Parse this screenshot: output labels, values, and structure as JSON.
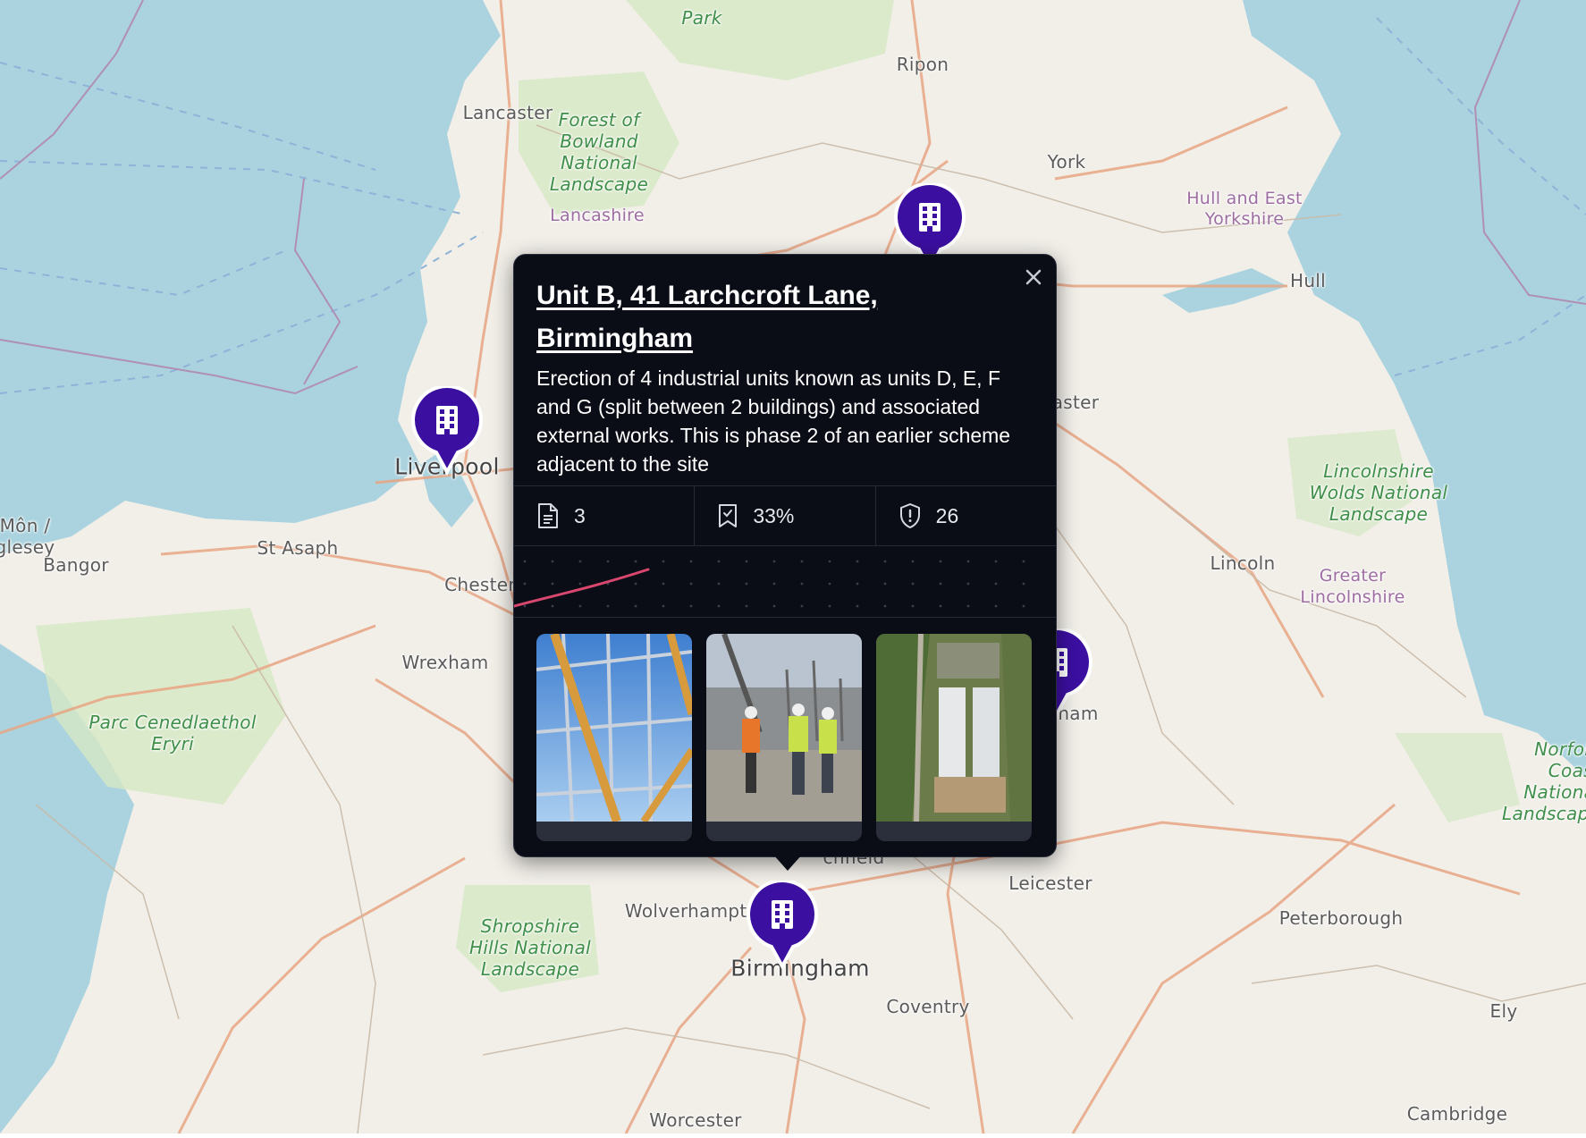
{
  "map": {
    "places": [
      {
        "name": "Park"
      },
      {
        "name": "Ripon"
      },
      {
        "name": "Lancaster"
      },
      {
        "name": "Forest of Bowland National Landscape"
      },
      {
        "name": "Lancashire"
      },
      {
        "name": "York"
      },
      {
        "name": "Hull and East Yorkshire"
      },
      {
        "name": "Hull"
      },
      {
        "name": "Liverpool"
      },
      {
        "name": "aster"
      },
      {
        "name": "Lincolnshire Wolds National Landscape"
      },
      {
        "name": "Môn / glesey"
      },
      {
        "name": "Bangor"
      },
      {
        "name": "St Asaph"
      },
      {
        "name": "Chester"
      },
      {
        "name": "Lincoln"
      },
      {
        "name": "Greater Lincolnshire"
      },
      {
        "name": "Wrexham"
      },
      {
        "name": "ham"
      },
      {
        "name": "Parc Cenedlaethol Eryri"
      },
      {
        "name": "Norfolk Coast National Landscape"
      },
      {
        "name": "Leicester"
      },
      {
        "name": "Wolverhampton"
      },
      {
        "name": "Peterborough"
      },
      {
        "name": "Shropshire Hills National Landscape"
      },
      {
        "name": "Birmingham"
      },
      {
        "name": "Coventry"
      },
      {
        "name": "Ely"
      },
      {
        "name": "Worcester"
      },
      {
        "name": "Cambridge"
      },
      {
        "name": "chfield"
      }
    ],
    "pins": [
      {
        "label": "Leeds site"
      },
      {
        "label": "Liverpool site"
      },
      {
        "label": "Nottingham site"
      },
      {
        "label": "Birmingham site"
      }
    ],
    "colors": {
      "sea": "#aad3df",
      "land": "#f2efe9",
      "park": "#d6e8c4",
      "road": "#e8a583",
      "pin": "#3b0fa0"
    }
  },
  "popup": {
    "title": "Unit B, 41 Larchcroft Lane, Birmingham",
    "description": "Erection of 4 industrial units known as units D, E, F and G (split between 2 buildings) and associated external works. This is phase 2 of an earlier scheme adjacent to the site",
    "stats": [
      {
        "icon": "document-icon",
        "value": "3"
      },
      {
        "icon": "bookmark-icon",
        "value": "33%"
      },
      {
        "icon": "shield-icon",
        "value": "26"
      }
    ],
    "sparkline": {
      "color": "#d9476f"
    },
    "photos": [
      {
        "icon": "steel-frame-photo"
      },
      {
        "icon": "construction-workers-photo"
      },
      {
        "icon": "aerial-site-photo"
      }
    ]
  }
}
